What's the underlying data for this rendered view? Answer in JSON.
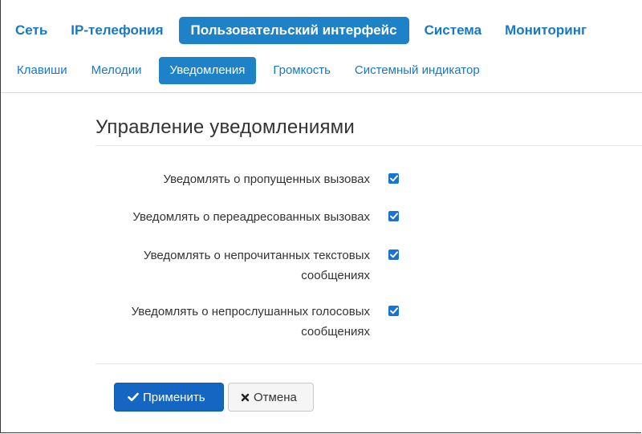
{
  "top_nav": {
    "items": [
      {
        "label": "Сеть"
      },
      {
        "label": "IP-телефония"
      },
      {
        "label": "Пользовательский интерфейс",
        "active": true
      },
      {
        "label": "Система"
      },
      {
        "label": "Мониторинг"
      }
    ]
  },
  "sub_nav": {
    "items": [
      {
        "label": "Клавиши"
      },
      {
        "label": "Мелодии"
      },
      {
        "label": "Уведомления",
        "active": true
      },
      {
        "label": "Громкость"
      },
      {
        "label": "Системный индикатор"
      }
    ]
  },
  "section": {
    "title": "Управление уведомлениями"
  },
  "settings": [
    {
      "label": "Уведомлять о пропущенных вызовах",
      "checked": true
    },
    {
      "label": "Уведомлять о переадресованных вызовах",
      "checked": true
    },
    {
      "label": "Уведомлять о непрочитанных текстовых сообщениях",
      "checked": true
    },
    {
      "label": "Уведомлять о непрослушанных голосовых сообщениях",
      "checked": true
    }
  ],
  "actions": {
    "apply_label": "Применить",
    "apply_icon": "check-icon",
    "cancel_label": "Отмена",
    "cancel_icon": "close-icon"
  },
  "colors": {
    "accent": "#1e82c8",
    "link": "#1878c4",
    "apply_button": "#1466c2",
    "checkbox": "#1a73d1"
  }
}
